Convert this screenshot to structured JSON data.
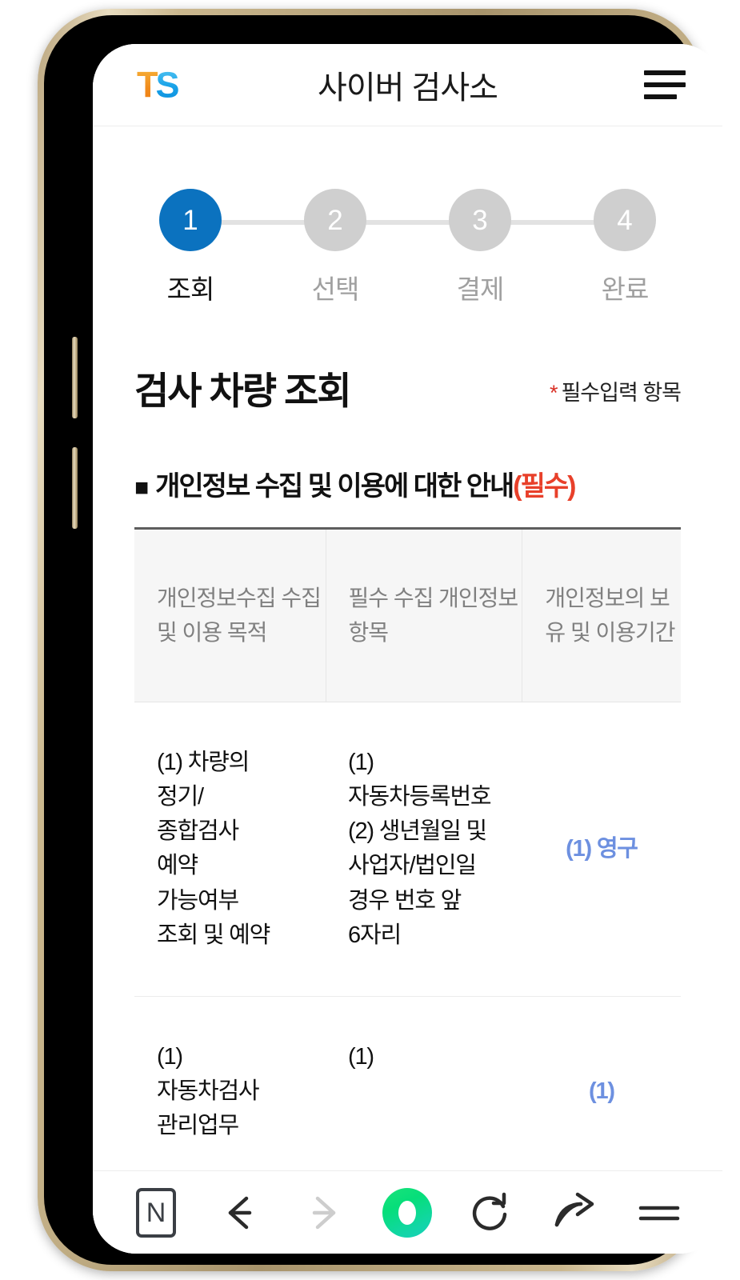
{
  "header": {
    "logo_t": "T",
    "logo_s": "S",
    "title": "사이버 검사소",
    "menu_label": "메뉴"
  },
  "stepper": {
    "steps": [
      {
        "number": "1",
        "label": "조회",
        "active": true
      },
      {
        "number": "2",
        "label": "선택",
        "active": false
      },
      {
        "number": "3",
        "label": "결제",
        "active": false
      },
      {
        "number": "4",
        "label": "완료",
        "active": false
      }
    ]
  },
  "page": {
    "title": "검사 차량 조회",
    "required_star": "*",
    "required_note": "필수입력 항목"
  },
  "privacy": {
    "bullet": "■",
    "heading": "개인정보 수집 및 이용에 대한 안내",
    "heading_required": "(필수)",
    "table": {
      "headers": [
        "개인정보수집\n수집 및 이용\n목적",
        "필수 수집\n개인정보 항목",
        "개인정보의\n보유 및\n이용기간"
      ],
      "rows": [
        {
          "purpose": "(1) 차량의\n정기/\n종합검사\n예약\n가능여부\n조회 및 예약",
          "items": "(1)\n자동차등록번호\n(2) 생년월일 및\n사업자/법인일\n경우 번호 앞\n6자리",
          "period": "(1) 영구"
        },
        {
          "purpose": "(1)\n자동차검사\n관리업무",
          "items": "(1)",
          "period": "(1)"
        }
      ]
    }
  },
  "browser_toolbar": {
    "naver_label": "N",
    "back_label": "뒤로",
    "forward_label": "앞으로",
    "home_label": "네이버 홈",
    "reload_label": "새로고침",
    "share_label": "공유",
    "menu_label": "메뉴"
  },
  "colors": {
    "accent_blue": "#0b72bf",
    "period_blue": "#6d90e0",
    "required_red": "#e8402a",
    "star_red": "#d93025",
    "step_inactive": "#cfcfcf",
    "naver_green": "#06de7a"
  }
}
